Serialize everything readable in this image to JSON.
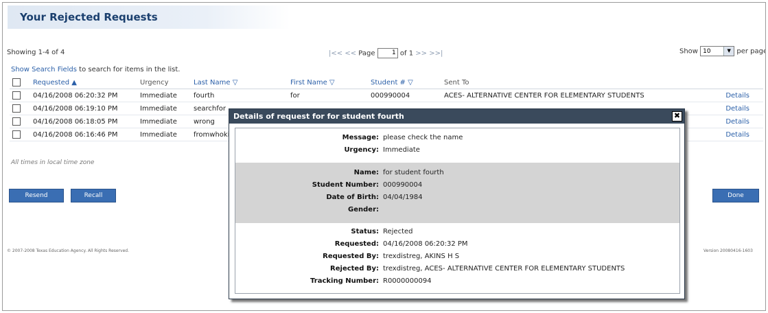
{
  "page": {
    "title": "Your Rejected Requests",
    "showing": "Showing 1-4 of 4",
    "show_search_link": "Show Search Fields",
    "show_search_rest": " to search for items in the list.",
    "times_note": "All times in local time zone",
    "copyright": "© 2007-2008 Texas Education Agency. All Rights Reserved.",
    "version": "Version 20080416-1603"
  },
  "pager": {
    "first": "|<<",
    "prev": "<<",
    "page_label": "Page",
    "page_value": "1",
    "of_label": "of 1",
    "next": ">>",
    "last": ">>|"
  },
  "per_page": {
    "show_label": "Show",
    "value": "10",
    "suffix": "per page"
  },
  "table": {
    "headers": {
      "requested": "Requested ▲",
      "urgency": "Urgency",
      "last_name": "Last Name ▽",
      "first_name": "First Name ▽",
      "student_num": "Student # ▽",
      "sent_to": "Sent To"
    },
    "rows": [
      {
        "requested": "04/16/2008 06:20:32 PM",
        "urgency": "Immediate",
        "last_name": "fourth",
        "first_name": "for",
        "student_num": "000990004",
        "sent_to": "ACES- ALTERNATIVE CENTER FOR ELEMENTARY STUDENTS",
        "details": "Details"
      },
      {
        "requested": "04/16/2008 06:19:10 PM",
        "urgency": "Immediate",
        "last_name": "searchfor",
        "first_name": "",
        "student_num": "",
        "sent_to": "",
        "details": "Details"
      },
      {
        "requested": "04/16/2008 06:18:05 PM",
        "urgency": "Immediate",
        "last_name": "wrong",
        "first_name": "",
        "student_num": "",
        "sent_to": "",
        "details": "Details"
      },
      {
        "requested": "04/16/2008 06:16:46 PM",
        "urgency": "Immediate",
        "last_name": "fromwhoki",
        "first_name": "",
        "student_num": "",
        "sent_to": "",
        "details": "Details"
      }
    ]
  },
  "buttons": {
    "resend": "Resend",
    "recall": "Recall",
    "done": "Done"
  },
  "modal": {
    "title": "Details of request for for student fourth",
    "close": "✖",
    "message_label": "Message:",
    "message": "please check the name",
    "urgency_label": "Urgency:",
    "urgency": "Immediate",
    "name_label": "Name:",
    "name": "for student fourth",
    "student_number_label": "Student Number:",
    "student_number": "000990004",
    "dob_label": "Date of Birth:",
    "dob": "04/04/1984",
    "gender_label": "Gender:",
    "gender": "",
    "status_label": "Status:",
    "status": "Rejected",
    "requested_label": "Requested:",
    "requested": "04/16/2008 06:20:32 PM",
    "requested_by_label": "Requested By:",
    "requested_by": "trexdistreg, AKINS H S",
    "rejected_by_label": "Rejected By:",
    "rejected_by": "trexdistreg, ACES- ALTERNATIVE CENTER FOR ELEMENTARY STUDENTS",
    "tracking_label": "Tracking Number:",
    "tracking": "R0000000094"
  },
  "colors": {
    "title_text": "#1a3f6e",
    "link": "#2a5fa8",
    "button": "#3a6eb3",
    "modal_header": "#3a4a5c",
    "modal_band": "#d4d4d4"
  }
}
